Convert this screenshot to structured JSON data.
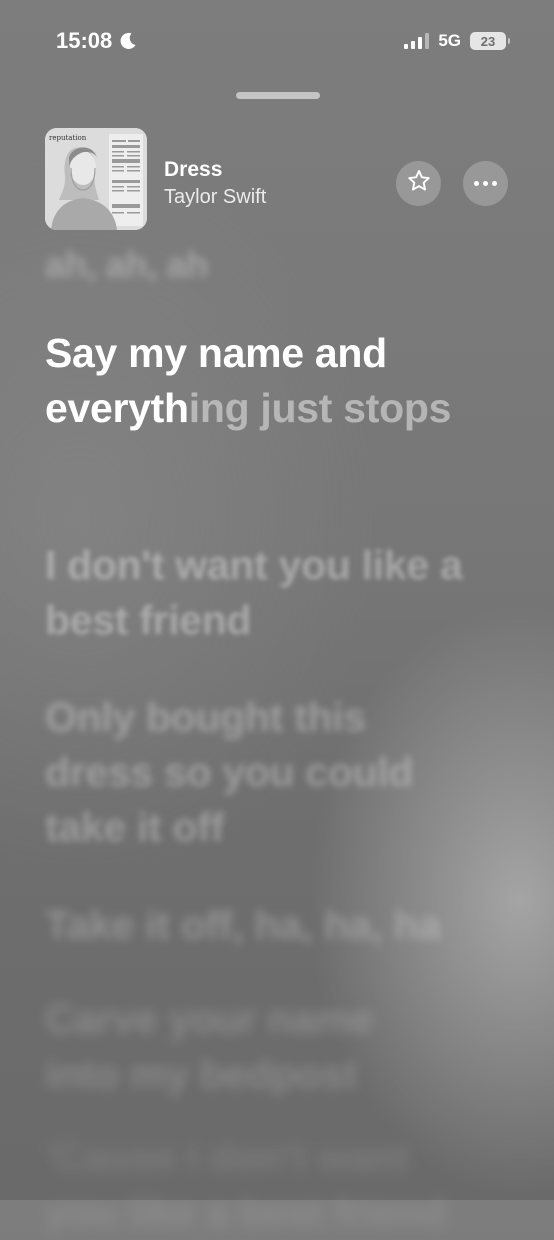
{
  "status_bar": {
    "time": "15:08",
    "network": "5G",
    "battery": "23"
  },
  "now_playing": {
    "title": "Dress",
    "artist": "Taylor Swift",
    "album_cover_text": "reputation"
  },
  "lyrics": {
    "previous": "ah, ah, ah",
    "current_sung": "Say my name and everyth",
    "current_unsung": "ing just stops",
    "next": [
      "I don't want you like a best friend",
      "Only bought this dress so you could take it off",
      "Take it off, ha, ha, ha",
      "Carve your name into my bedpost",
      "'Cause I don't want you like a best friend"
    ]
  },
  "colors": {
    "background": "#777777",
    "text_primary": "#ffffff"
  },
  "icons": {
    "moon": "moon-icon",
    "signal": "signal-icon",
    "battery": "battery-icon",
    "favorite": "star-icon",
    "more": "ellipsis-icon"
  }
}
